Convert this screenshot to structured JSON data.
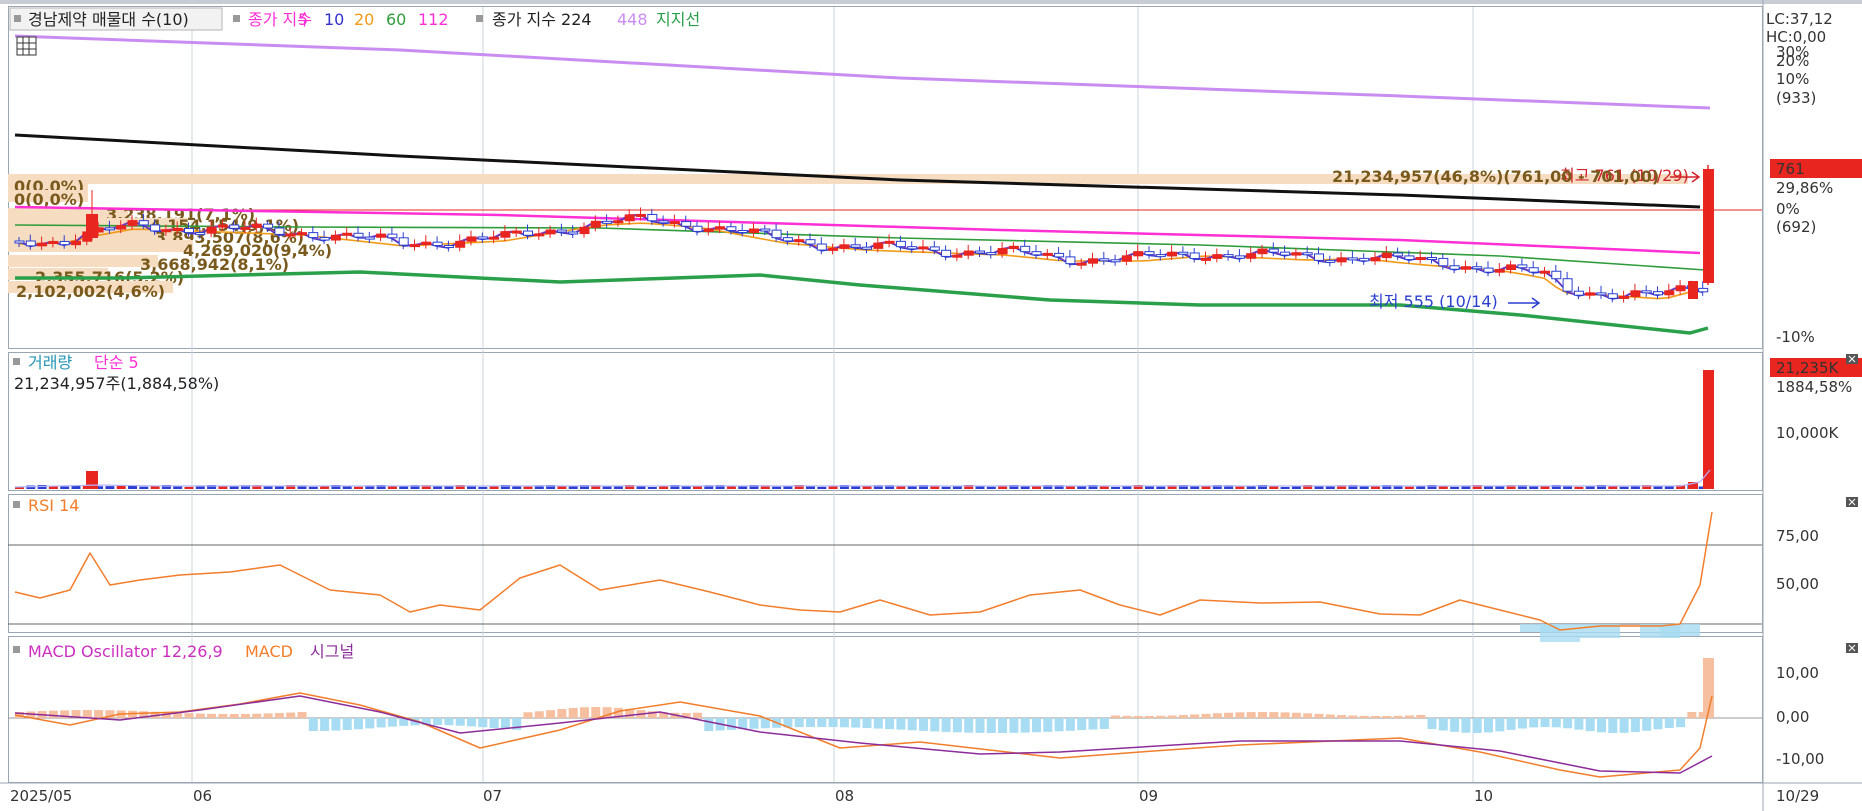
{
  "colors": {
    "up": "#e8251f",
    "down": "#2a3fd1",
    "ma5": "#3333cc",
    "ma10": "#9a3db8",
    "ma20": "#f29b19",
    "ma60": "#2e9c3a",
    "ma112": "#ff2fd6",
    "ma224": "#111111",
    "ma448": "#c98df2",
    "support": "#2aa04a",
    "rsi": "#f27d2b",
    "macd": "#f27d2b",
    "signal": "#8b2c9a",
    "osc_pos": "#f6bfa0",
    "osc_neg": "#a8dcf2",
    "grid": "#c9d4de",
    "profile": "#f6dcc0"
  },
  "price_panel": {
    "title": "경남제약 매물대 수(10)",
    "ma_prefix": "종가 지수",
    "ma_periods": [
      "5",
      "10",
      "20",
      "60",
      "112"
    ],
    "ma_long_label": "종가 지수 224",
    "ma_longest": "448",
    "support_label": "지지선",
    "lc": "LC:37,12",
    "hc": "HC:0,00",
    "high_annotation": "최고 761 (10/29)",
    "low_annotation": "최저 555 (10/14)",
    "volume_annotation": "21,234,957(46,8%)(761,00 - 701,00)",
    "profile_labels": [
      "0(0,0%)",
      "0(0,0%)",
      "3,238,191(7,1%)",
      "4,154,154(9,1%)",
      "3,893,507(8,6%)",
      "4,269,020(9,4%)",
      "3,668,942(8,1%)",
      "2,355,716(5,2%)",
      "2,102,002(4,6%)"
    ],
    "axis_labels": [
      "30%",
      "20%",
      "10%",
      "(933)",
      "0%",
      "(692)",
      "-10%"
    ],
    "last_price": "761",
    "last_change": "29,86%"
  },
  "volume_panel": {
    "title": "거래량",
    "ma_label": "단순 5",
    "value_label": "21,234,957주(1,884,58%)",
    "axis_label": "10,000K",
    "last_value": "21,235K",
    "last_pct": "1884,58%"
  },
  "rsi_panel": {
    "title": "RSI 14",
    "axis_labels": [
      "75,00",
      "50,00"
    ]
  },
  "macd_panel": {
    "title": "MACD Oscillator 12,26,9",
    "macd_label": "MACD",
    "signal_label": "시그널",
    "axis_labels": [
      "10,00",
      "0,00",
      "-10,00"
    ]
  },
  "x_axis": {
    "labels": [
      "2025/05",
      "06",
      "07",
      "08",
      "09",
      "10",
      "10/29"
    ]
  },
  "chart_data": {
    "type": "candlestick",
    "symbol": "경남제약",
    "panels": [
      "price",
      "volume",
      "rsi",
      "macd"
    ],
    "x_range": [
      "2025/05",
      "10/29"
    ],
    "price_markers": {
      "high": 761,
      "high_date": "10/29",
      "low": 555,
      "low_date": "10/14"
    },
    "volume_profile": [
      {
        "label": "0(0,0%)",
        "volume": 0,
        "pct": 0.0
      },
      {
        "label": "0(0,0%)",
        "volume": 0,
        "pct": 0.0
      },
      {
        "label": "21,234,957(46,8%)",
        "volume": 21234957,
        "pct": 46.8,
        "price_range": [
          701,
          761
        ]
      },
      {
        "label": "3,238,191(7,1%)",
        "volume": 3238191,
        "pct": 7.1
      },
      {
        "label": "4,154,154(9,1%)",
        "volume": 4154154,
        "pct": 9.1
      },
      {
        "label": "3,893,507(8,6%)",
        "volume": 3893507,
        "pct": 8.6
      },
      {
        "label": "4,269,020(9,4%)",
        "volume": 4269020,
        "pct": 9.4
      },
      {
        "label": "3,668,942(8,1%)",
        "volume": 3668942,
        "pct": 8.1
      },
      {
        "label": "2,355,716(5,2%)",
        "volume": 2355716,
        "pct": 5.2
      },
      {
        "label": "2,102,002(4,6%)",
        "volume": 2102002,
        "pct": 4.6
      }
    ],
    "last_volume": 21234957,
    "last_volume_change_pct": 1884.58,
    "last_change_pct": 29.86,
    "rsi_levels": [
      70,
      30
    ],
    "rsi_last": 85,
    "macd_last": 4,
    "signal_last": -9,
    "oscillator_last": 14
  }
}
